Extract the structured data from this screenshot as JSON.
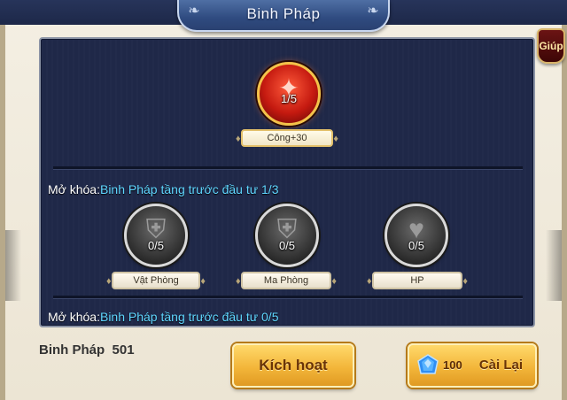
{
  "window": {
    "title": "Binh Pháp",
    "help_label": "Giúp"
  },
  "tiers": [
    {
      "skills": [
        {
          "icon": "blade-slash-icon",
          "progress": "1/5",
          "stat": "Công+30",
          "unlocked": true
        }
      ]
    },
    {
      "unlock_label": "Mở khóa:",
      "unlock_requirement": "Binh Pháp tầng trước đầu tư 1/3",
      "skills": [
        {
          "icon": "shield-icon",
          "progress": "0/5",
          "stat": "Vật Phòng",
          "unlocked": false
        },
        {
          "icon": "shield-icon",
          "progress": "0/5",
          "stat": "Ma Phòng",
          "unlocked": false
        },
        {
          "icon": "heart-icon",
          "progress": "0/5",
          "stat": "HP",
          "unlocked": false
        }
      ]
    },
    {
      "unlock_label": "Mở khóa:",
      "unlock_requirement": "Binh Pháp tầng trước đầu tư 0/5"
    }
  ],
  "footer": {
    "points_label": "Binh Pháp",
    "points_value": "501",
    "activate_label": "Kích hoạt",
    "reset_cost": "100",
    "reset_label": "Cài Lại",
    "gem_icon": "blue-gem-icon"
  },
  "colors": {
    "panel_bg": "#1f2848",
    "unlock_requirement": "#5fd6ff",
    "button_gold": "#f3b63a"
  }
}
